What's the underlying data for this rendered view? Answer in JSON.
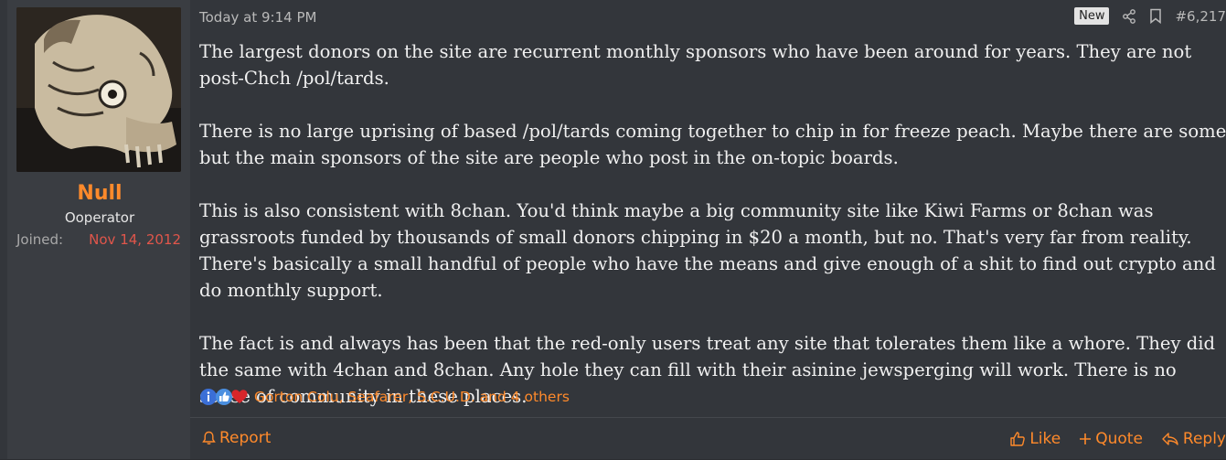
{
  "author": {
    "name": "Null",
    "title": "Ooperator",
    "joined_label": "Joined:",
    "joined_date": "Nov 14, 2012"
  },
  "post": {
    "timestamp": "Today at 9:14 PM",
    "badge": "New",
    "number": "#6,217",
    "paragraphs": [
      "The largest donors on the site are recurrent monthly sponsors who have been around for years. They are not post-Chch /pol/tards.",
      "There is no large uprising of based /pol/tards coming together to chip in for freeze peach. Maybe there are some but the main sponsors of the site are people who post in the on-topic boards.",
      "This is also consistent with 8chan. You'd think maybe a big community site like Kiwi Farms or 8chan was grassroots funded by thousands of small donors chipping in $20 a month, but no. That's very far from reality. There's basically a small handful of people who have the means and give enough of a shit to find out crypto and do monthly support.",
      "The fact is and always has been that the red-only users treat any site that tolerates them like a whore. They did the same with 4chan and 8chan. Any hole they can fill with their asinine jewsperging will work. There is no sense of community in these places."
    ],
    "reactions_text": "Gorton Colu, Seafarer, S.C.U.D. and 4 others"
  },
  "footer": {
    "report": "Report",
    "like": "Like",
    "quote": "Quote",
    "reply": "Reply"
  },
  "colors": {
    "accent": "#ff8a2b",
    "joined_date": "#e0564b"
  },
  "icons": {
    "share": "share-icon",
    "bookmark": "bookmark-icon",
    "report": "bell-icon",
    "like": "thumbs-up-icon",
    "quote": "plus-icon",
    "reply": "reply-icon",
    "reactions": [
      "informative-icon",
      "like-reaction-icon",
      "heart-reaction-icon"
    ]
  }
}
